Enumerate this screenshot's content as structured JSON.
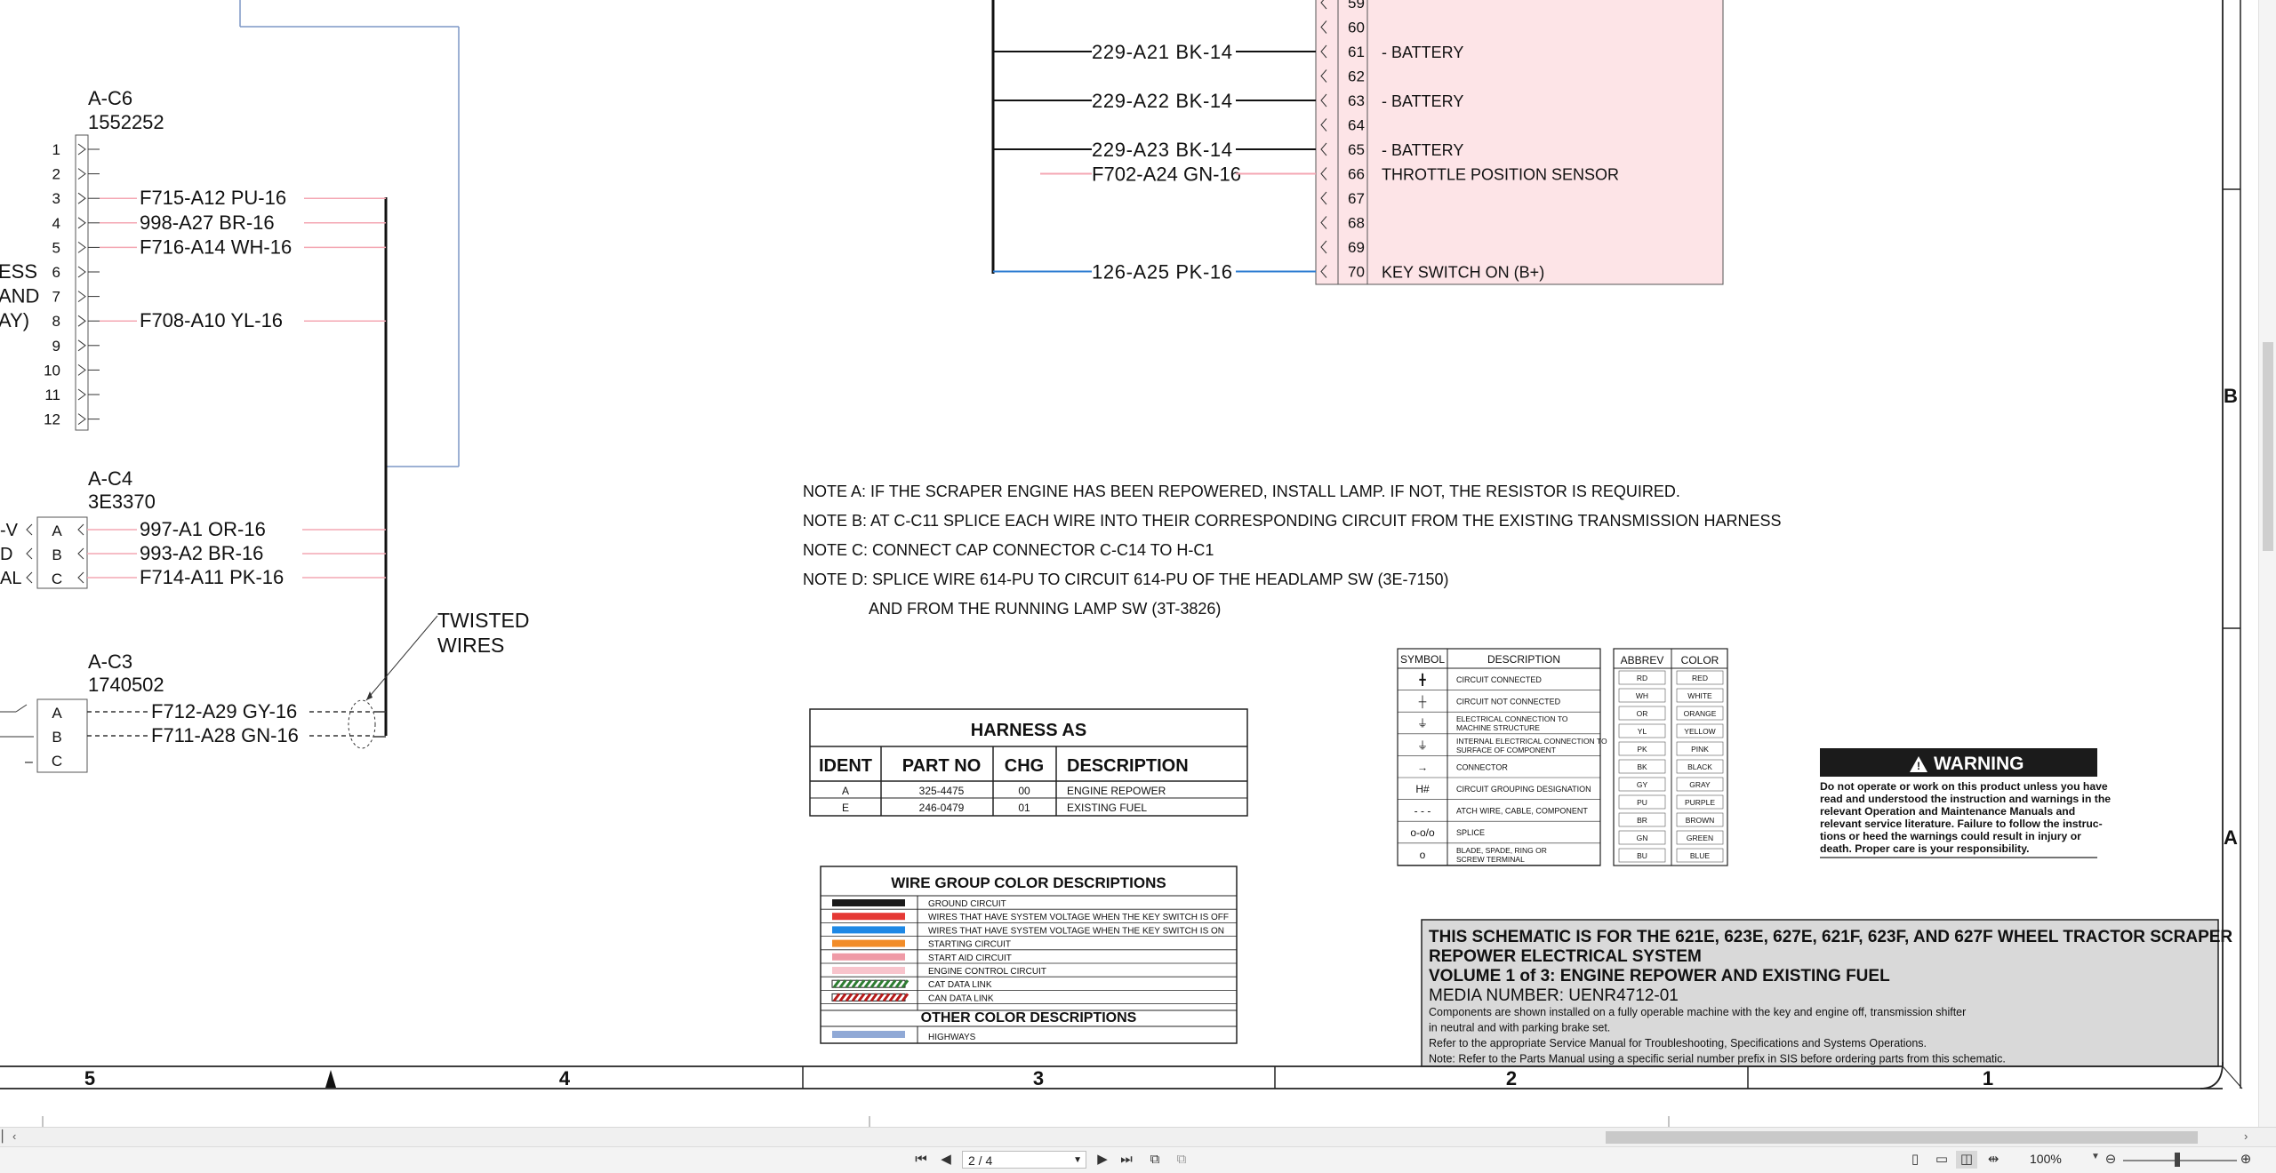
{
  "connector_c6": {
    "name": "A-C6",
    "part": "1552252",
    "pins": [
      "1",
      "2",
      "3",
      "4",
      "5",
      "6",
      "7",
      "8",
      "9",
      "10",
      "11",
      "12"
    ],
    "wires": [
      {
        "pin": "3",
        "label": "F715-A12 PU-16"
      },
      {
        "pin": "4",
        "label": "998-A27 BR-16"
      },
      {
        "pin": "5",
        "label": "F716-A14 WH-16"
      },
      {
        "pin": "8",
        "label": "F708-A10 YL-16"
      }
    ],
    "side_labels": [
      "ESS",
      "AND",
      "AY)"
    ]
  },
  "connector_c4": {
    "name": "A-C4",
    "part": "3E3370",
    "pins": [
      "A",
      "B",
      "C"
    ],
    "left_labels": [
      "-V",
      "D",
      "AL"
    ],
    "wires": [
      {
        "pin": "A",
        "label": "997-A1 OR-16"
      },
      {
        "pin": "B",
        "label": "993-A2 BR-16"
      },
      {
        "pin": "C",
        "label": "F714-A11 PK-16"
      }
    ]
  },
  "connector_c3": {
    "name": "A-C3",
    "part": "1740502",
    "pins": [
      "A",
      "B",
      "C"
    ],
    "wires": [
      {
        "pin": "A",
        "label": "F712-A29 GY-16"
      },
      {
        "pin": "B",
        "label": "F711-A28 GN-16"
      }
    ]
  },
  "twisted_label": [
    "TWISTED",
    "WIRES"
  ],
  "ecm_block": {
    "pins": [
      {
        "num": "59",
        "desc": ""
      },
      {
        "num": "60",
        "desc": ""
      },
      {
        "num": "61",
        "desc": "- BATTERY",
        "wire": "229-A21 BK-14"
      },
      {
        "num": "62",
        "desc": ""
      },
      {
        "num": "63",
        "desc": "- BATTERY",
        "wire": "229-A22 BK-14"
      },
      {
        "num": "64",
        "desc": ""
      },
      {
        "num": "65",
        "desc": "- BATTERY",
        "wire": "229-A23 BK-14"
      },
      {
        "num": "66",
        "desc": "THROTTLE POSITION SENSOR",
        "wire": "F702-A24 GN-16"
      },
      {
        "num": "67",
        "desc": ""
      },
      {
        "num": "68",
        "desc": ""
      },
      {
        "num": "69",
        "desc": ""
      },
      {
        "num": "70",
        "desc": "KEY SWITCH ON (B+)",
        "wire": "126-A25 PK-16"
      }
    ]
  },
  "notes": [
    "NOTE A: IF THE SCRAPER ENGINE HAS BEEN REPOWERED, INSTALL LAMP. IF NOT, THE RESISTOR IS REQUIRED.",
    "NOTE B: AT C-C11 SPLICE EACH WIRE INTO THEIR CORRESPONDING CIRCUIT FROM THE EXISTING TRANSMISSION HARNESS",
    "NOTE C: CONNECT CAP CONNECTOR C-C14 TO H-C1",
    "NOTE D: SPLICE WIRE 614-PU TO CIRCUIT 614-PU OF THE HEADLAMP SW (3E-7150)",
    "AND FROM THE RUNNING LAMP SW (3T-3826)"
  ],
  "harness_table": {
    "title": "HARNESS AS",
    "headers": [
      "IDENT",
      "PART NO",
      "CHG",
      "DESCRIPTION"
    ],
    "rows": [
      [
        "A",
        "325-4475",
        "00",
        "ENGINE REPOWER"
      ],
      [
        "E",
        "246-0479",
        "01",
        "EXISTING FUEL"
      ]
    ]
  },
  "wire_group": {
    "title": "WIRE GROUP COLOR DESCRIPTIONS",
    "rows": [
      {
        "color": "#1a1a1a",
        "label": "GROUND CIRCUIT"
      },
      {
        "color": "#e53935",
        "label": "WIRES THAT HAVE SYSTEM VOLTAGE WHEN THE KEY SWITCH IS OFF"
      },
      {
        "color": "#1e88e5",
        "label": "WIRES THAT HAVE SYSTEM VOLTAGE WHEN THE KEY SWITCH IS ON"
      },
      {
        "color": "#f28c28",
        "label": "STARTING CIRCUIT"
      },
      {
        "color": "#ef9aa6",
        "label": "START AID CIRCUIT"
      },
      {
        "color": "#f8c4cc",
        "label": "ENGINE CONTROL CIRCUIT"
      },
      {
        "color": "#2e7d32",
        "label": "CAT DATA LINK",
        "striped": true
      },
      {
        "color": "#b71c1c",
        "label": "CAN DATA LINK",
        "striped": true
      }
    ],
    "other_title": "OTHER COLOR DESCRIPTIONS",
    "other_rows": [
      {
        "color": "#90a9d6",
        "label": "HIGHWAYS"
      }
    ]
  },
  "symbol_table": {
    "headers": [
      "SYMBOL",
      "DESCRIPTION"
    ],
    "rows": [
      {
        "sym": "╋",
        "desc": "CIRCUIT CONNECTED"
      },
      {
        "sym": "┼",
        "desc": "CIRCUIT NOT CONNECTED"
      },
      {
        "sym": "⏚",
        "desc": "ELECTRICAL CONNECTION TO MACHINE STRUCTURE"
      },
      {
        "sym": "⏚",
        "desc": "INTERNAL ELECTRICAL CONNECTION TO SURFACE OF COMPONENT"
      },
      {
        "sym": "→",
        "desc": "CONNECTOR"
      },
      {
        "sym": "H#",
        "desc": "CIRCUIT GROUPING DESIGNATION"
      },
      {
        "sym": "- - -",
        "desc": "ATCH WIRE, CABLE, COMPONENT"
      },
      {
        "sym": "o-o/o",
        "desc": "SPLICE"
      },
      {
        "sym": "o",
        "desc": "BLADE, SPADE, RING OR SCREW TERMINAL"
      }
    ]
  },
  "color_table": {
    "headers": [
      "ABBREV",
      "COLOR"
    ],
    "rows": [
      [
        "RD",
        "RED"
      ],
      [
        "WH",
        "WHITE"
      ],
      [
        "OR",
        "ORANGE"
      ],
      [
        "YL",
        "YELLOW"
      ],
      [
        "PK",
        "PINK"
      ],
      [
        "BK",
        "BLACK"
      ],
      [
        "GY",
        "GRAY"
      ],
      [
        "PU",
        "PURPLE"
      ],
      [
        "BR",
        "BROWN"
      ],
      [
        "GN",
        "GREEN"
      ],
      [
        "BU",
        "BLUE"
      ]
    ]
  },
  "warning": {
    "title": "WARNING",
    "lines": [
      "Do not operate or work on this product unless you have",
      "read and understood the instruction and warnings in the",
      "relevant Operation and Maintenance Manuals and",
      "relevant service literature. Failure to follow the instruc-",
      "tions or heed the warnings could result in injury or",
      "death. Proper care is your responsibility."
    ]
  },
  "title_block": {
    "line1": "THIS SCHEMATIC IS FOR THE 621E, 623E, 627E, 621F, 623F, AND 627F WHEEL TRACTOR SCRAPER",
    "line2": "REPOWER ELECTRICAL SYSTEM",
    "line3": "VOLUME 1 of 3: ENGINE REPOWER AND EXISTING FUEL",
    "line4": "MEDIA NUMBER: UENR4712-01",
    "small": [
      "Components are shown installed on a fully operable machine with the key and engine off, transmission shifter",
      "in neutral and with parking brake set.",
      "Refer to the appropriate Service Manual for Troubleshooting, Specifications and Systems Operations.",
      "Note: Refer to the Parts Manual using a specific serial number prefix in SIS before ordering parts from this schematic."
    ]
  },
  "zones": {
    "columns": [
      "5",
      "4",
      "3",
      "2",
      "1"
    ],
    "rows": [
      "B",
      "A"
    ]
  },
  "viewer": {
    "page_field": "2 / 4",
    "zoom": "100%"
  }
}
